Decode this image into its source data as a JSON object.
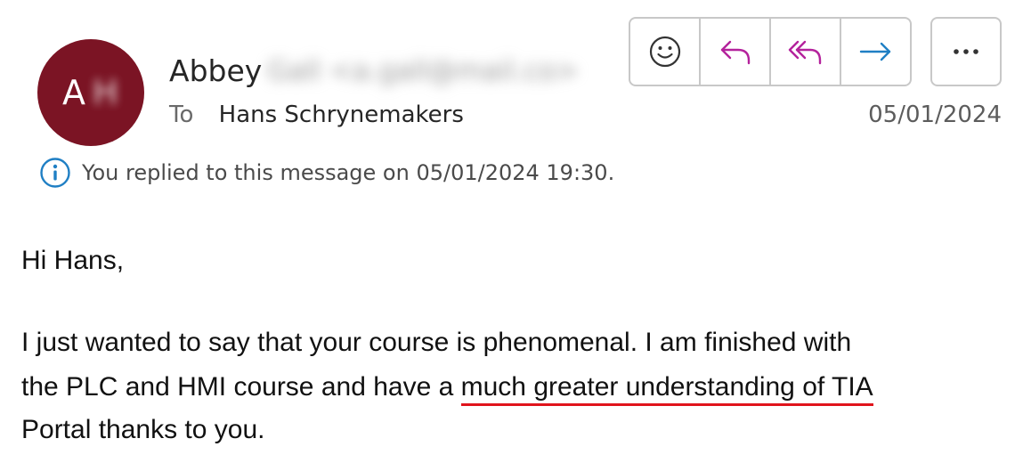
{
  "sender": {
    "avatar_initial": "A",
    "avatar_initial_blurred": "H",
    "avatar_color": "#7b1424",
    "name": "Abbey",
    "email_blurred": "Gall <a.gall@mail.co>"
  },
  "recipient": {
    "to_label": "To",
    "name": "Hans Schrynemakers"
  },
  "date": "05/01/2024",
  "toolbar": {
    "buttons": [
      {
        "icon": "emoji-smile-icon",
        "name": "react-button"
      },
      {
        "icon": "reply-icon",
        "name": "reply-button"
      },
      {
        "icon": "reply-all-icon",
        "name": "reply-all-button"
      },
      {
        "icon": "forward-icon",
        "name": "forward-button"
      }
    ],
    "more_icon": "more-icon",
    "reply_color": "#b4229c",
    "forward_color": "#1f7fc4"
  },
  "info": {
    "icon": "info-icon",
    "text": "You replied to this message on 05/01/2024 19:30.",
    "icon_color": "#1f7fc4"
  },
  "body": {
    "greeting": "Hi Hans,",
    "line1": "I just wanted to say that your course is phenomenal. I am finished with",
    "line2_plain": "the PLC and HMI course and have a ",
    "line2_underlined": "much greater understanding of TIA",
    "line3": "Portal thanks to you.",
    "underline_color": "#e0141c"
  }
}
